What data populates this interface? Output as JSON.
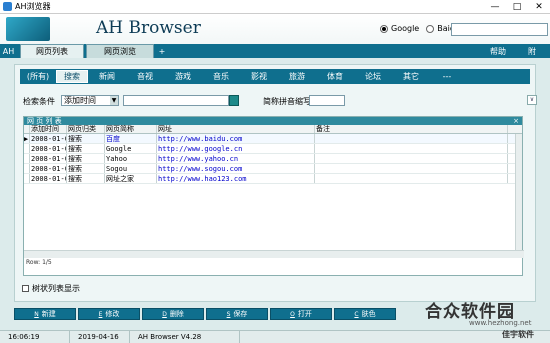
{
  "window": {
    "title": "AH浏览器"
  },
  "header": {
    "brand": "AH Browser",
    "engines": [
      {
        "label": "Google",
        "selected": true
      },
      {
        "label": "Baidu",
        "selected": false
      }
    ],
    "search_value": ""
  },
  "menubar": {
    "ah_label": "AH",
    "tabs": [
      "网页列表",
      "网页浏览"
    ],
    "add_label": "+",
    "help_label": "帮助",
    "close_label": "附"
  },
  "categories": [
    "(所有)",
    "搜索",
    "新闻",
    "音视",
    "游戏",
    "音乐",
    "影视",
    "旅游",
    "体育",
    "论坛",
    "其它",
    "---"
  ],
  "active_category": "搜索",
  "filter": {
    "label": "检索条件",
    "select_value": "添加时间",
    "keyword_value": "",
    "abbr_label": "简称拼音缩写",
    "abbr_value": ""
  },
  "grid": {
    "caption": "网 页 列 表",
    "close": "×",
    "columns": [
      "添加时间",
      "网页归类",
      "网页简称",
      "网址",
      "备注"
    ],
    "rows": [
      {
        "time": "2008-01-0",
        "cat": "搜索",
        "name": "百度",
        "url": "http://www.baidu.com",
        "note": ""
      },
      {
        "time": "2008-01-0",
        "cat": "搜索",
        "name": "Google",
        "url": "http://www.google.cn",
        "note": ""
      },
      {
        "time": "2008-01-0",
        "cat": "搜索",
        "name": "Yahoo",
        "url": "http://www.yahoo.cn",
        "note": ""
      },
      {
        "time": "2008-01-0",
        "cat": "搜索",
        "name": "Sogou",
        "url": "http://www.sogou.com",
        "note": ""
      },
      {
        "time": "2008-01-0",
        "cat": "搜索",
        "name": "网址之家",
        "url": "http://www.hao123.com",
        "note": ""
      }
    ],
    "row_count": "Row: 1/5"
  },
  "tree_toggle_label": "树状列表显示",
  "toolbar": [
    {
      "key": "N",
      "label": "新建"
    },
    {
      "key": "E",
      "label": "修改"
    },
    {
      "key": "D",
      "label": "删除"
    },
    {
      "key": "S",
      "label": "保存"
    },
    {
      "key": "O",
      "label": "打开"
    },
    {
      "key": "C",
      "label": "肤色"
    }
  ],
  "status": {
    "time": "16:06:19",
    "date": "2019-04-16",
    "version": "AH Browser V4.28"
  },
  "watermark": {
    "big": "合众软件园",
    "url": "www.hezhong.net",
    "small": "佳宇软件"
  },
  "colors": {
    "accent": "#0f6f8e",
    "panel": "#eef6f6",
    "url": "#0000cc"
  }
}
